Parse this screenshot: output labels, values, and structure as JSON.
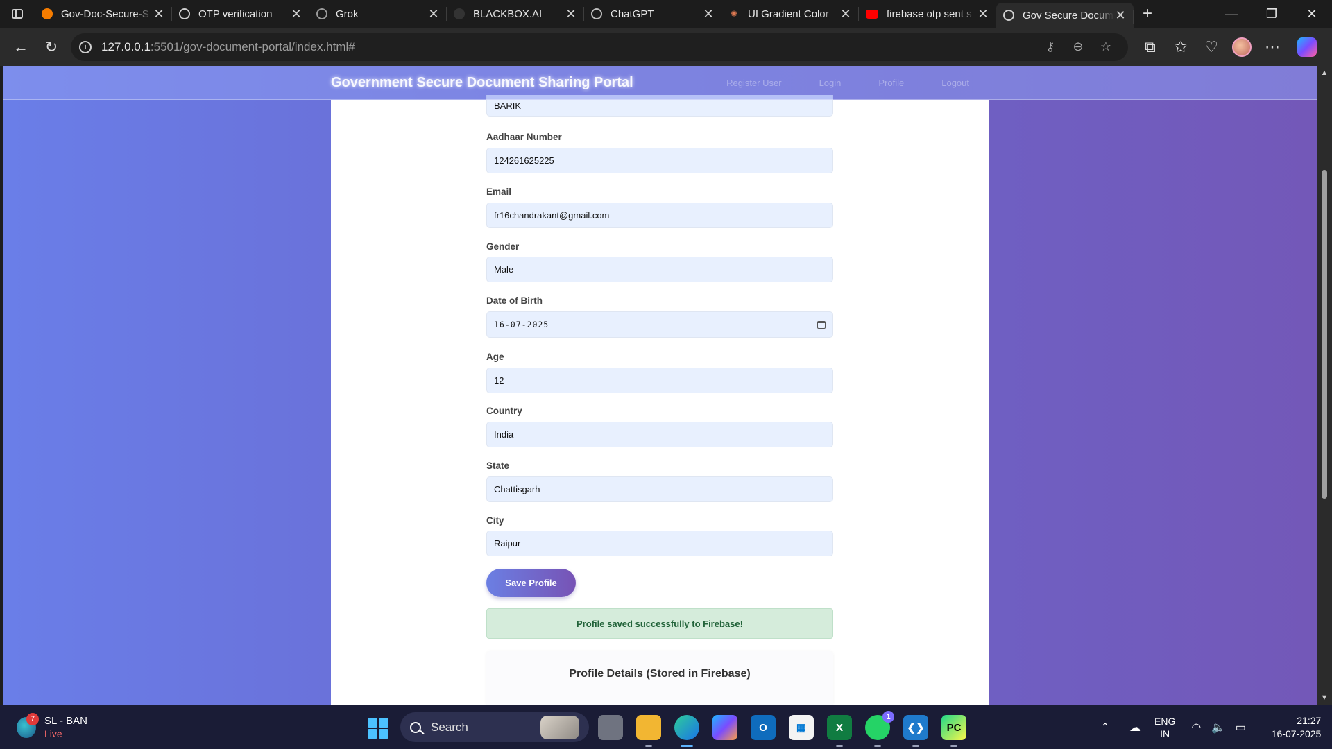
{
  "browser": {
    "tabs": [
      {
        "title": "Gov-Doc-Secure-S",
        "icon": "firebase-icon",
        "color": "#f57c00"
      },
      {
        "title": "OTP verification",
        "icon": "globe-icon",
        "color": "#cfcfcf"
      },
      {
        "title": "Grok",
        "icon": "grok-icon",
        "color": "#cfcfcf"
      },
      {
        "title": "BLACKBOX.AI",
        "icon": "blackbox-icon",
        "color": "#444444"
      },
      {
        "title": "ChatGPT",
        "icon": "chatgpt-icon",
        "color": "#cfcfcf"
      },
      {
        "title": "UI Gradient Color",
        "icon": "claude-icon",
        "color": "#e07a52"
      },
      {
        "title": "firebase otp sent s",
        "icon": "youtube-icon",
        "color": "#ff0000"
      },
      {
        "title": "Gov Secure Docum",
        "icon": "globe-icon",
        "color": "#cfcfcf",
        "active": true
      }
    ],
    "url_host": "127.0.0.1",
    "url_rest": ":5501/gov-document-portal/index.html#"
  },
  "site": {
    "title": "Government Secure Document Sharing Portal",
    "nav": [
      "Register User",
      "Login",
      "Profile",
      "Logout"
    ]
  },
  "form": {
    "last_name_value": "BARIK",
    "fields": [
      {
        "label": "Aadhaar Number",
        "value": "124261625225"
      },
      {
        "label": "Email",
        "value": "fr16chandrakant@gmail.com"
      },
      {
        "label": "Gender",
        "value": "Male"
      },
      {
        "label": "Date of Birth",
        "value": "16-07-2025"
      },
      {
        "label": "Age",
        "value": "12"
      },
      {
        "label": "Country",
        "value": "India"
      },
      {
        "label": "State",
        "value": "Chattisgarh"
      },
      {
        "label": "City",
        "value": "Raipur"
      }
    ],
    "save_label": "Save Profile",
    "success_message": "Profile saved successfully to Firebase!",
    "details_title": "Profile Details (Stored in Firebase)"
  },
  "taskbar": {
    "weather_line1": "SL - BAN",
    "weather_line2": "Live",
    "weather_badge": "7",
    "search_label": "Search",
    "whatsapp_badge": "1",
    "lang_line1": "ENG",
    "lang_line2": "IN",
    "time": "21:27",
    "date": "16-07-2025"
  },
  "colors": {
    "page_gradient_start": "#6a7ee8",
    "page_gradient_end": "#7358b8",
    "accent": "#7753b5",
    "success_bg": "#d5ecdb"
  }
}
